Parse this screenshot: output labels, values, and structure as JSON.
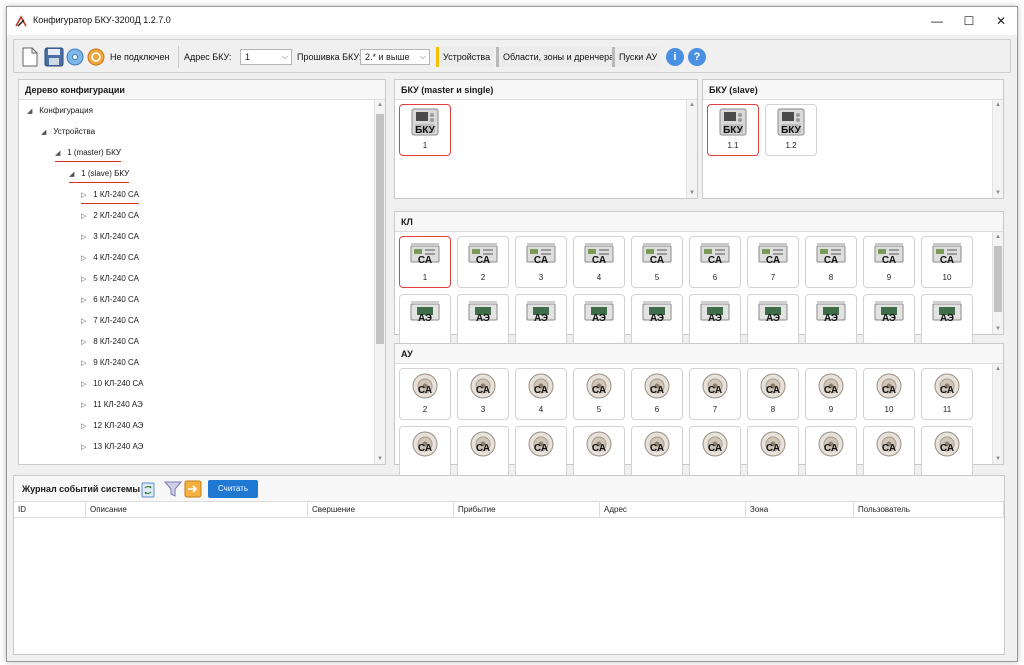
{
  "window": {
    "title": "Конфигуратор БКУ-3200Д 1.2.7.0",
    "min_label": "—",
    "max_label": "☐",
    "close_label": "✕"
  },
  "toolbar": {
    "status": "Не подключен",
    "address_label": "Адрес БКУ:",
    "address_value": "1",
    "firmware_label": "Прошивка БКУ:",
    "firmware_value": "2.* и выше",
    "tab_devices": "Устройства",
    "tab_areas": "Области, зоны и дренчера",
    "tab_starts": "Пуски АУ",
    "info_label": "i",
    "help_label": "?"
  },
  "tree": {
    "title": "Дерево конфигурации",
    "items": [
      {
        "label": "Конфигурация",
        "exp": "◢"
      },
      {
        "label": "Устройства",
        "exp": "◢"
      },
      {
        "label": "1 (master) БКУ",
        "exp": "◢"
      },
      {
        "label": "1 (slave) БКУ",
        "exp": "◢"
      },
      {
        "label": "1 КЛ-240 СА",
        "exp": "▷"
      },
      {
        "label": "2 КЛ-240 СА",
        "exp": "▷"
      },
      {
        "label": "3 КЛ-240 СА",
        "exp": "▷"
      },
      {
        "label": "4 КЛ-240 СА",
        "exp": "▷"
      },
      {
        "label": "5 КЛ-240 СА",
        "exp": "▷"
      },
      {
        "label": "6 КЛ-240 СА",
        "exp": "▷"
      },
      {
        "label": "7 КЛ-240 СА",
        "exp": "▷"
      },
      {
        "label": "8 КЛ-240 СА",
        "exp": "▷"
      },
      {
        "label": "9 КЛ-240 СА",
        "exp": "▷"
      },
      {
        "label": "10 КЛ-240 СА",
        "exp": "▷"
      },
      {
        "label": "11 КЛ-240 АЭ",
        "exp": "▷"
      },
      {
        "label": "12 КЛ-240 АЭ",
        "exp": "▷"
      },
      {
        "label": "13 КЛ-240 АЭ",
        "exp": "▷"
      }
    ]
  },
  "bku_master": {
    "title": "БКУ (master и single)",
    "tiles": [
      {
        "label": "БКУ",
        "num": "1",
        "selected": true
      }
    ]
  },
  "bku_slave": {
    "title": "БКУ (slave)",
    "tiles": [
      {
        "label": "БКУ",
        "num": "1.1",
        "selected": true
      },
      {
        "label": "БКУ",
        "num": "1.2",
        "selected": false
      }
    ]
  },
  "kl": {
    "title": "КЛ",
    "row1": [
      {
        "label": "СА",
        "num": "1",
        "selected": true
      },
      {
        "label": "СА",
        "num": "2"
      },
      {
        "label": "СА",
        "num": "3"
      },
      {
        "label": "СА",
        "num": "4"
      },
      {
        "label": "СА",
        "num": "5"
      },
      {
        "label": "СА",
        "num": "6"
      },
      {
        "label": "СА",
        "num": "7"
      },
      {
        "label": "СА",
        "num": "8"
      },
      {
        "label": "СА",
        "num": "9"
      },
      {
        "label": "СА",
        "num": "10"
      }
    ],
    "row2": [
      "АЭ",
      "АЭ",
      "АЭ",
      "АЭ",
      "АЭ",
      "АЭ",
      "АЭ",
      "АЭ",
      "АЭ",
      "АЭ"
    ]
  },
  "au": {
    "title": "АУ",
    "row1": [
      {
        "label": "СА",
        "num": "2"
      },
      {
        "label": "СА",
        "num": "3"
      },
      {
        "label": "СА",
        "num": "4"
      },
      {
        "label": "СА",
        "num": "5"
      },
      {
        "label": "СА",
        "num": "6"
      },
      {
        "label": "СА",
        "num": "7"
      },
      {
        "label": "СА",
        "num": "8"
      },
      {
        "label": "СА",
        "num": "9"
      },
      {
        "label": "СА",
        "num": "10"
      },
      {
        "label": "СА",
        "num": "11"
      }
    ],
    "row2": [
      "СА",
      "СА",
      "СА",
      "СА",
      "СА",
      "СА",
      "СА",
      "СА",
      "СА",
      "СА"
    ]
  },
  "log": {
    "title": "Журнал событий системы |",
    "read_button": "Считать",
    "columns": [
      "ID",
      "Описание",
      "Свершение",
      "Прибытие",
      "Адрес",
      "Зона",
      "Пользователь"
    ]
  },
  "colors": {
    "accent": "#1f78d1",
    "selection": "#e04040",
    "active_tab": "#f2c200"
  }
}
